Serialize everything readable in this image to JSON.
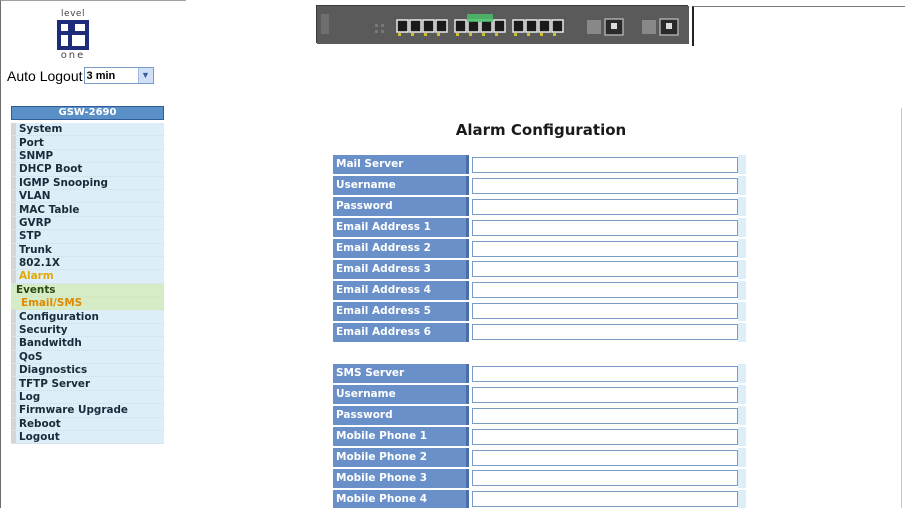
{
  "logo": {
    "top_text": "level",
    "bottom_text": "one"
  },
  "auto_logout": {
    "label": "Auto Logout",
    "value": "3 min"
  },
  "menu": {
    "model": "GSW-2690",
    "items": [
      {
        "label": "System",
        "state": "normal"
      },
      {
        "label": "Port",
        "state": "normal"
      },
      {
        "label": "SNMP",
        "state": "normal"
      },
      {
        "label": "DHCP Boot",
        "state": "normal"
      },
      {
        "label": "IGMP Snooping",
        "state": "normal"
      },
      {
        "label": "VLAN",
        "state": "normal"
      },
      {
        "label": "MAC Table",
        "state": "normal"
      },
      {
        "label": "GVRP",
        "state": "normal"
      },
      {
        "label": "STP",
        "state": "normal"
      },
      {
        "label": "Trunk",
        "state": "normal"
      },
      {
        "label": "802.1X",
        "state": "normal"
      },
      {
        "label": "Alarm",
        "state": "active"
      },
      {
        "label": "Events",
        "state": "sub"
      },
      {
        "label": "Email/SMS",
        "state": "sub-current"
      },
      {
        "label": "Configuration",
        "state": "normal"
      },
      {
        "label": "Security",
        "state": "normal"
      },
      {
        "label": "Bandwitdh",
        "state": "normal"
      },
      {
        "label": "QoS",
        "state": "normal"
      },
      {
        "label": "Diagnostics",
        "state": "normal"
      },
      {
        "label": "TFTP Server",
        "state": "normal"
      },
      {
        "label": "Log",
        "state": "normal"
      },
      {
        "label": "Firmware Upgrade",
        "state": "normal"
      },
      {
        "label": "Reboot",
        "state": "normal"
      },
      {
        "label": "Logout",
        "state": "normal"
      }
    ]
  },
  "page_title": "Alarm Configuration",
  "email_section": {
    "rows": [
      {
        "label": "Mail Server",
        "value": ""
      },
      {
        "label": "Username",
        "value": ""
      },
      {
        "label": "Password",
        "value": ""
      },
      {
        "label": "Email Address 1",
        "value": ""
      },
      {
        "label": "Email Address 2",
        "value": ""
      },
      {
        "label": "Email Address 3",
        "value": ""
      },
      {
        "label": "Email Address 4",
        "value": ""
      },
      {
        "label": "Email Address 5",
        "value": ""
      },
      {
        "label": "Email Address 6",
        "value": ""
      }
    ]
  },
  "sms_section": {
    "rows": [
      {
        "label": "SMS Server",
        "value": ""
      },
      {
        "label": "Username",
        "value": ""
      },
      {
        "label": "Password",
        "value": ""
      },
      {
        "label": "Mobile Phone 1",
        "value": ""
      },
      {
        "label": "Mobile Phone 2",
        "value": ""
      },
      {
        "label": "Mobile Phone 3",
        "value": ""
      },
      {
        "label": "Mobile Phone 4",
        "value": ""
      }
    ]
  },
  "colors": {
    "label_bg": "#6990c8",
    "menu_bg": "#ddeef8",
    "active_menu": "#e0a800",
    "sub_menu_bg": "#d6ecc6"
  }
}
